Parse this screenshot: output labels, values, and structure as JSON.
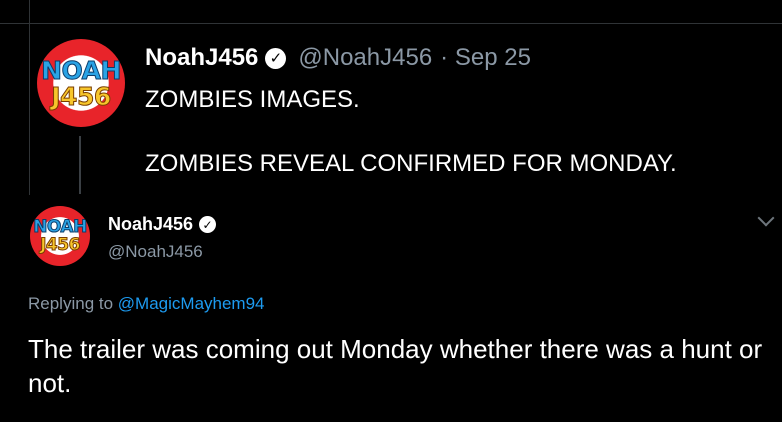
{
  "tweet1": {
    "avatar_text": [
      "NOAH",
      "J456"
    ],
    "name": "NoahJ456",
    "handle": "@NoahJ456",
    "separator": "·",
    "date": "Sep 25",
    "lines": [
      "ZOMBIES IMAGES.",
      "ZOMBIES REVEAL CONFIRMED FOR MONDAY."
    ]
  },
  "reply": {
    "avatar_text": [
      "NOAH",
      "J456"
    ],
    "name": "NoahJ456",
    "handle": "@NoahJ456",
    "replying_prefix": "Replying to",
    "replying_to": "@MagicMayhem94",
    "text": "The trailer was coming out Monday whether there was a hunt or not."
  },
  "icons": {
    "verified": "verified-badge-icon",
    "more": "chevron-down-icon"
  },
  "colors": {
    "background": "#000000",
    "secondary_text": "#8b98a5",
    "link": "#1d9bf0"
  }
}
